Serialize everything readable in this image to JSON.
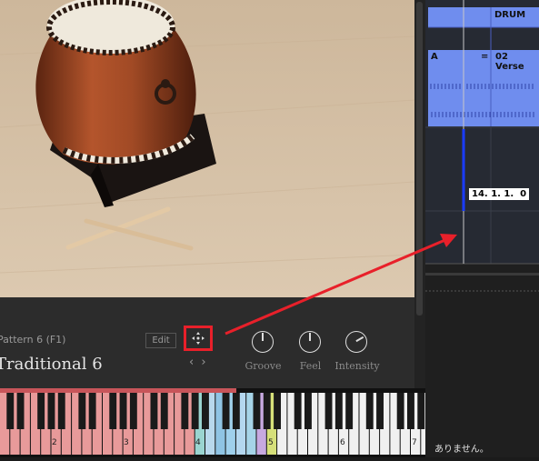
{
  "instrument": {
    "pattern_label": "Pattern 6 (F1)",
    "edit_label": "Edit",
    "preset_name": "Traditional 6",
    "nav_arrows": "‹ ›",
    "knobs": [
      {
        "label": "Groove",
        "level": 0.5
      },
      {
        "label": "Feel",
        "level": 0.5
      },
      {
        "label": "Intensity",
        "level": 0.75
      }
    ],
    "move_icon": "move-arrows-icon"
  },
  "keyboard": {
    "octave_labels": [
      "2",
      "3",
      "4",
      "5",
      "6",
      "7"
    ]
  },
  "daw": {
    "track_name": "DRUM",
    "clip_letter": "A",
    "marker_eq": "=",
    "clip_name": "02 Verse",
    "position_display": "14. 1. 1.  0",
    "bottom_text": "ありません。"
  },
  "colors": {
    "clip_blue": "#6f8dee",
    "annotation_red": "#e8202a"
  }
}
